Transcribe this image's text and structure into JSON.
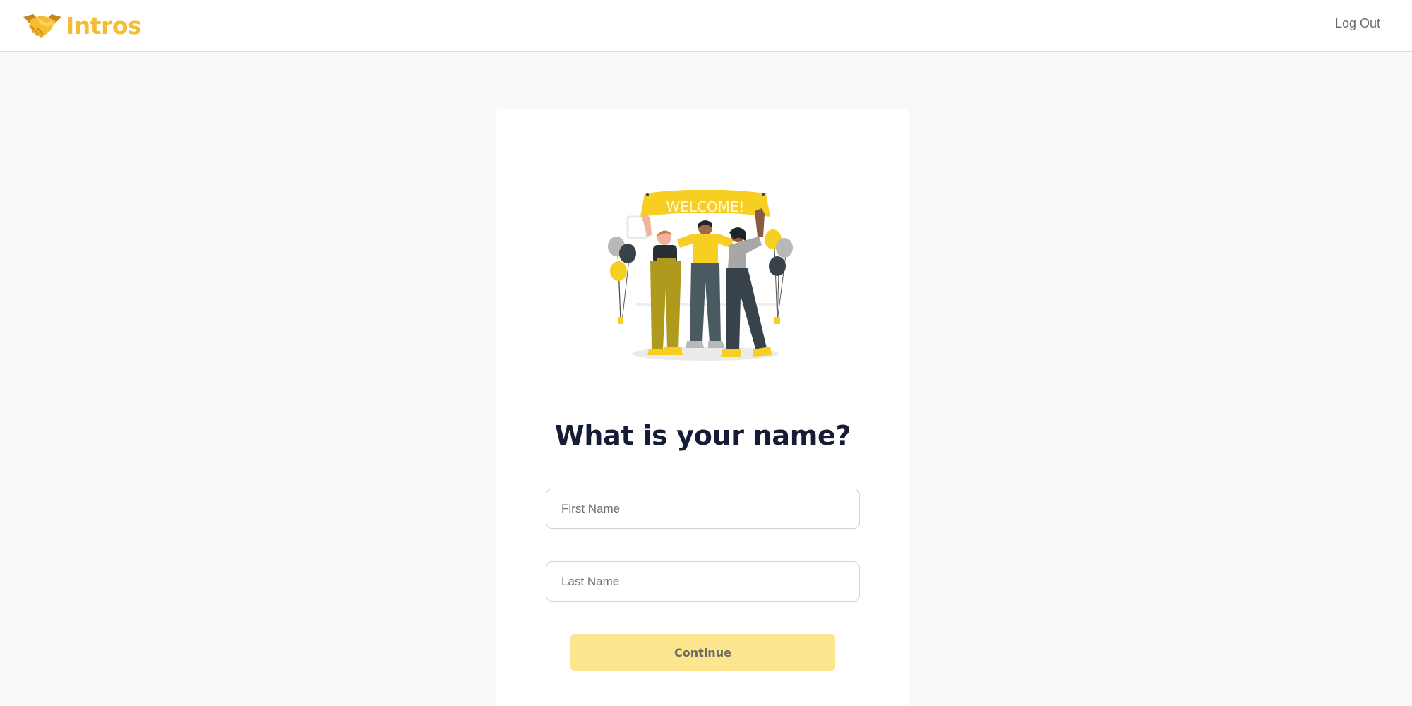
{
  "colors": {
    "brand": "#f5bd31",
    "title": "#161c36",
    "button_bg": "#fde58e",
    "button_text": "#6b6b6b",
    "illustration_yellow": "#f7cf23"
  },
  "header": {
    "brand_icon": "handshake-icon",
    "brand_name": "Intros",
    "logout_label": "Log Out"
  },
  "main": {
    "illustration": {
      "icon": "welcome-illustration",
      "banner_text": "WELCOME!"
    },
    "title": "What is your name?",
    "first_name": {
      "placeholder": "First Name",
      "value": ""
    },
    "last_name": {
      "placeholder": "Last Name",
      "value": ""
    },
    "continue_label": "Continue"
  }
}
